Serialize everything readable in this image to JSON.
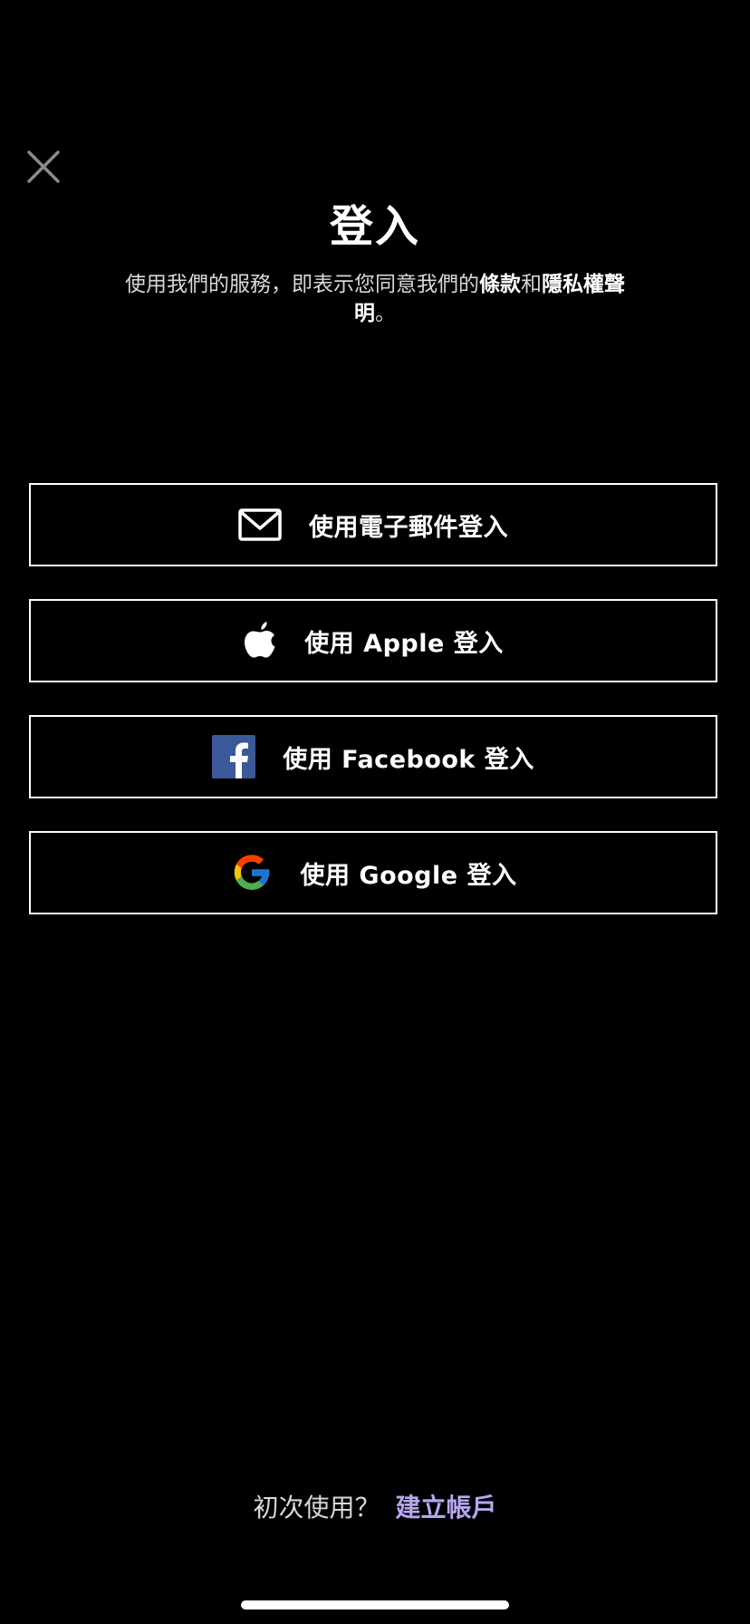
{
  "title": "登入",
  "subtitle": {
    "prefix": "使用我們的服務，即表示您同意我們的",
    "terms_link": "條款",
    "conjunction": "和",
    "privacy_link": "隱私權聲明",
    "suffix": "。"
  },
  "buttons": [
    {
      "id": "email",
      "icon": "mail-icon",
      "label": "使用電子郵件登入"
    },
    {
      "id": "apple",
      "icon": "apple-icon",
      "label": "使用 Apple 登入"
    },
    {
      "id": "facebook",
      "icon": "facebook-icon",
      "label": "使用 Facebook 登入"
    },
    {
      "id": "google",
      "icon": "google-icon",
      "label": "使用 Google 登入"
    }
  ],
  "footer": {
    "prompt": "初次使用？",
    "create_account": "建立帳戶"
  },
  "colors": {
    "background": "#000000",
    "accent_link": "#b7a7f0",
    "facebook_blue": "#3b5998",
    "close_icon": "#8a8a8a"
  }
}
